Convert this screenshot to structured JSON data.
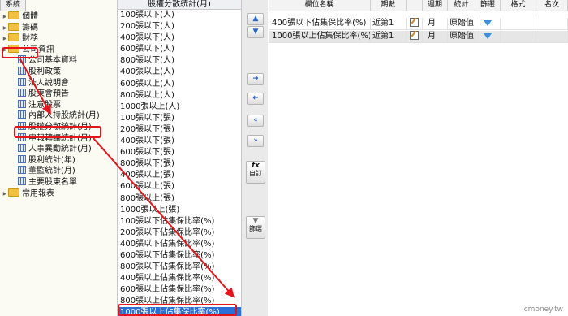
{
  "tree": {
    "tab": "系統",
    "items": [
      {
        "label": "個體",
        "type": "folder",
        "indent": 0
      },
      {
        "label": "籌碼",
        "type": "folder",
        "indent": 0
      },
      {
        "label": "財務",
        "type": "folder",
        "indent": 0
      },
      {
        "label": "公司資訊",
        "type": "folder",
        "indent": 0
      },
      {
        "label": "公司基本資料",
        "type": "table",
        "indent": 1
      },
      {
        "label": "股利政策",
        "type": "table",
        "indent": 1
      },
      {
        "label": "法人說明會",
        "type": "table",
        "indent": 1
      },
      {
        "label": "股東會預告",
        "type": "table",
        "indent": 1
      },
      {
        "label": "注意股票",
        "type": "table",
        "indent": 1
      },
      {
        "label": "內部人持股統計(月)",
        "type": "table",
        "indent": 1
      },
      {
        "label": "股權分散統計(月)",
        "type": "table",
        "indent": 1
      },
      {
        "label": "申報轉讓統計(月)",
        "type": "table",
        "indent": 1
      },
      {
        "label": "人事異動統計(月)",
        "type": "table",
        "indent": 1
      },
      {
        "label": "股利統計(年)",
        "type": "table",
        "indent": 1
      },
      {
        "label": "董監統計(月)",
        "type": "table",
        "indent": 1
      },
      {
        "label": "主要股東名單",
        "type": "table",
        "indent": 1
      },
      {
        "label": "常用報表",
        "type": "folder",
        "indent": 0
      }
    ]
  },
  "fields": {
    "header": "股權分散統計(月)",
    "items": [
      "100張以下(人)",
      "200張以下(人)",
      "400張以下(人)",
      "600張以下(人)",
      "800張以下(人)",
      "400張以上(人)",
      "600張以上(人)",
      "800張以上(人)",
      "1000張以上(人)",
      "100張以下(張)",
      "200張以下(張)",
      "400張以下(張)",
      "600張以下(張)",
      "800張以下(張)",
      "400張以上(張)",
      "600張以上(張)",
      "800張以上(張)",
      "1000張以上(張)",
      "100張以下佔集保比率(%)",
      "200張以下佔集保比率(%)",
      "400張以下佔集保比率(%)",
      "600張以下佔集保比率(%)",
      "800張以下佔集保比率(%)",
      "400張以上佔集保比率(%)",
      "600張以上佔集保比率(%)",
      "800張以上佔集保比率(%)",
      "1000張以上佔集保比率(%)"
    ],
    "selected_index": 26
  },
  "buttons": {
    "custom_label": "自訂",
    "filter_label": "篩選"
  },
  "grid": {
    "headers": [
      "欄位名稱",
      "期數",
      "",
      "週期",
      "統計",
      "篩選",
      "格式",
      "名次"
    ],
    "rows": [
      {
        "name": "400張以下佔集保比率(%)",
        "period": "近第1",
        "cycle": "月",
        "stat": "原始值"
      },
      {
        "name": "1000張以上佔集保比率(%)",
        "period": "近第1",
        "cycle": "月",
        "stat": "原始值"
      }
    ]
  },
  "watermark": "cmoney.tw",
  "colors": {
    "accent_selection": "#2b6fd6",
    "annotation": "#e3141a"
  }
}
